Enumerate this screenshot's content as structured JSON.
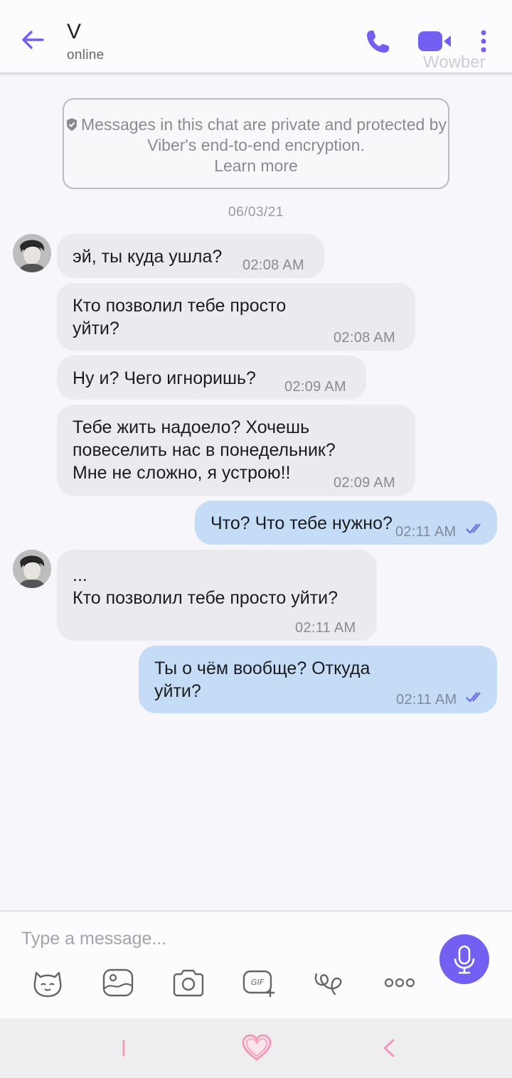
{
  "header": {
    "contact_name": "V",
    "status": "online",
    "watermark": "Wowber",
    "accent_color": "#7360f2"
  },
  "notice": {
    "text": "Messages in this chat are private and protected by Viber's end-to-end encryption.",
    "learn_more": "Learn more"
  },
  "date_label": "06/03/21",
  "messages": [
    {
      "direction": "incoming",
      "text": "эй, ты куда ушла?",
      "time": "02:08 AM"
    },
    {
      "direction": "incoming",
      "text": "Кто позволил тебе просто\nуйти?",
      "time": "02:08 AM"
    },
    {
      "direction": "incoming",
      "text": "Ну и? Чего игноришь?",
      "time": "02:09 AM"
    },
    {
      "direction": "incoming",
      "text": "Тебе жить надоело? Хочешь\nповеселить нас в понедельник?\nМне не сложно, я устрою!!",
      "time": "02:09 AM"
    },
    {
      "direction": "outgoing",
      "text": "Что? Что тебе нужно?",
      "time": "02:11 AM",
      "status": "read"
    },
    {
      "direction": "incoming",
      "text": "...\nКто позволил тебе просто уйти?",
      "time": "02:11 AM"
    },
    {
      "direction": "outgoing",
      "text": "Ты о чём вообще? Откуда\nуйти?",
      "time": "02:11 AM",
      "status": "read"
    }
  ],
  "composer": {
    "placeholder": "Type a message...",
    "tools": [
      "sticker-icon",
      "gallery-icon",
      "camera-icon",
      "gif-icon",
      "doodle-icon",
      "more-options-icon"
    ]
  },
  "nav": [
    "recent-apps-icon",
    "home-heart-icon",
    "back-icon"
  ]
}
